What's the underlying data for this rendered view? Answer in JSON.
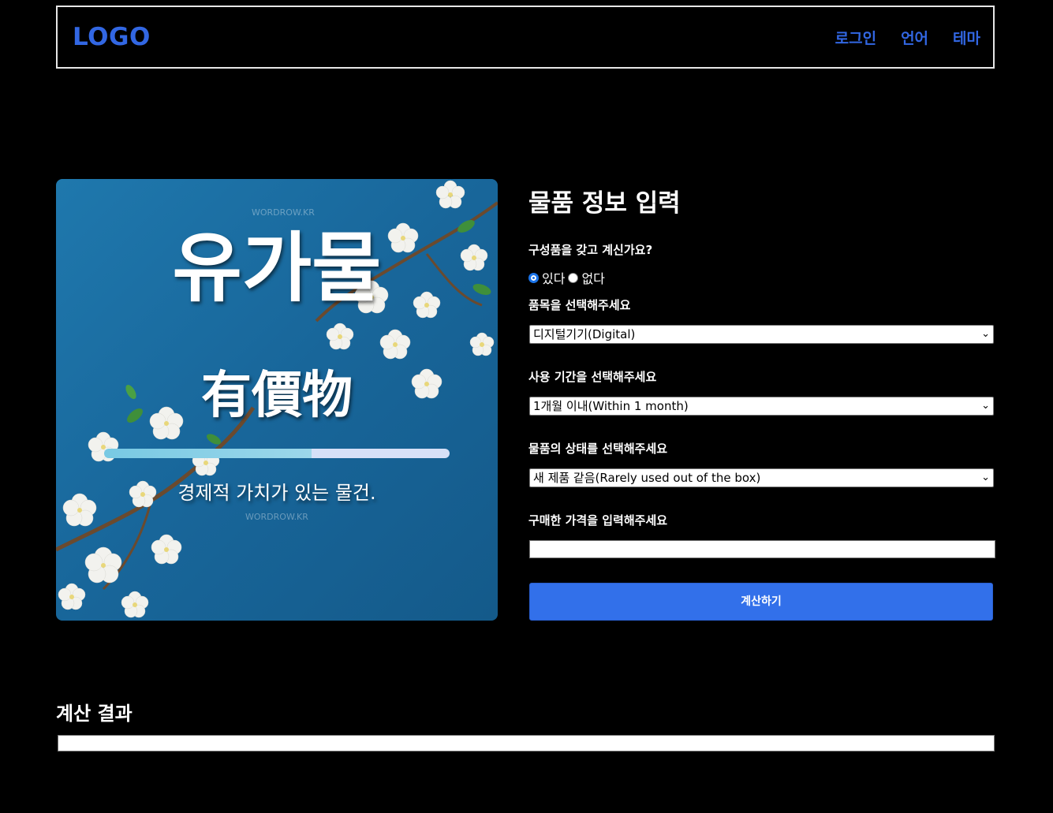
{
  "header": {
    "logo": "LOGO",
    "nav": [
      {
        "label": "로그인"
      },
      {
        "label": "언어"
      },
      {
        "label": "테마"
      }
    ]
  },
  "hero": {
    "watermark": "WORDROW.KR",
    "title_ko": "유가물",
    "title_hanja": "有價物",
    "subtitle": "경제적 가치가 있는 물건.",
    "progress": 0.6,
    "background_color": "#18669a"
  },
  "form": {
    "title": "물품 정보 입력",
    "components_question": "구성품을 갖고 계신가요?",
    "radio_yes": "있다",
    "radio_no": "없다",
    "radio_selected": "있다",
    "category_label": "품목을 선택해주세요",
    "category_value": "디지털기기(Digital)",
    "period_label": "사용 기간을 선택해주세요",
    "period_value": "1개월 이내(Within 1 month)",
    "condition_label": "물품의 상태를 선택해주세요",
    "condition_value": "새 제품 같음(Rarely used out of the box)",
    "price_label": "구매한 가격을 입력해주세요",
    "price_value": "",
    "submit_label": "계산하기"
  },
  "result": {
    "title": "계산 결과",
    "value": ""
  },
  "colors": {
    "accent": "#3267e3",
    "button": "#3270ea",
    "background": "#000000"
  }
}
